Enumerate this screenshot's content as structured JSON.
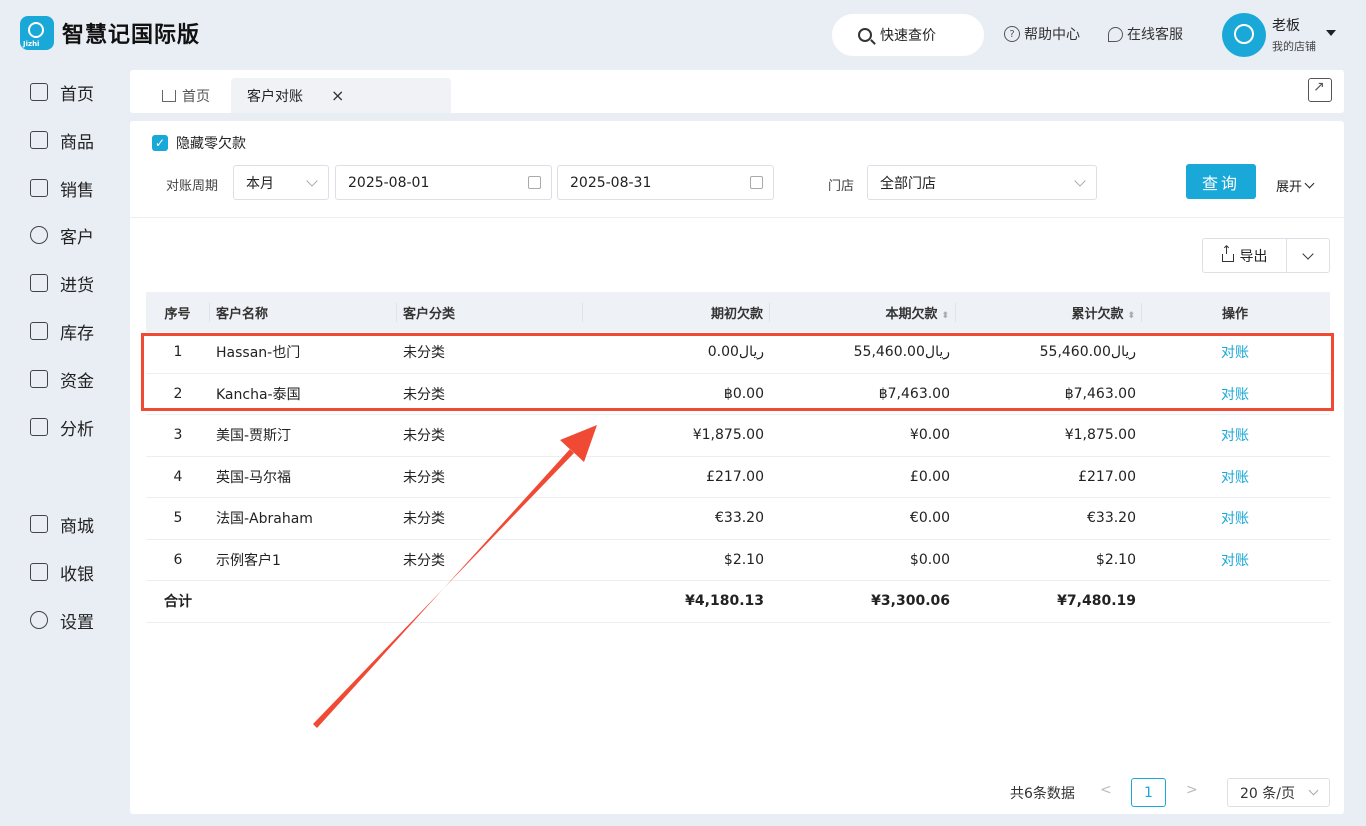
{
  "app": {
    "title": "智慧记国际版",
    "logo_tag": "Jizhi"
  },
  "header": {
    "quick_search": "快速查价",
    "help": "帮助中心",
    "service": "在线客服",
    "user_name": "老板",
    "user_store": "我的店铺"
  },
  "sidebar": {
    "items": [
      {
        "label": "首页",
        "icon": "home-icon"
      },
      {
        "label": "商品",
        "icon": "bag-icon"
      },
      {
        "label": "销售",
        "icon": "clipboard-icon"
      },
      {
        "label": "客户",
        "icon": "person-icon"
      },
      {
        "label": "进货",
        "icon": "box-icon"
      },
      {
        "label": "库存",
        "icon": "warehouse-icon"
      },
      {
        "label": "资金",
        "icon": "wallet-icon"
      },
      {
        "label": "分析",
        "icon": "chart-icon"
      },
      {
        "label": "商城",
        "icon": "shop-icon"
      },
      {
        "label": "收银",
        "icon": "cashier-icon"
      },
      {
        "label": "设置",
        "icon": "gear-icon"
      }
    ]
  },
  "tabs": {
    "home": "首页",
    "active": "客户对账",
    "close": "×"
  },
  "filters": {
    "hide_zero_label": "隐藏零欠款",
    "period_label": "对账周期",
    "period_value": "本月",
    "start_date": "2025-08-01",
    "end_date": "2025-08-31",
    "store_label": "门店",
    "store_value": "全部门店",
    "query_button": "查询",
    "expand_label": "展开"
  },
  "export": {
    "label": "导出"
  },
  "table": {
    "headers": [
      "序号",
      "客户名称",
      "客户分类",
      "期初欠款",
      "本期欠款",
      "累计欠款",
      "操作"
    ],
    "rows": [
      {
        "no": "1",
        "name": "Hassan-也门",
        "category": "未分类",
        "opening": "0.00ريال",
        "current": "55,460.00ريال",
        "cumulative": "55,460.00ريال",
        "action": "对账"
      },
      {
        "no": "2",
        "name": "Kancha-泰国",
        "category": "未分类",
        "opening": "฿0.00",
        "current": "฿7,463.00",
        "cumulative": "฿7,463.00",
        "action": "对账"
      },
      {
        "no": "3",
        "name": "美国-贾斯汀",
        "category": "未分类",
        "opening": "¥1,875.00",
        "current": "¥0.00",
        "cumulative": "¥1,875.00",
        "action": "对账"
      },
      {
        "no": "4",
        "name": "英国-马尔福",
        "category": "未分类",
        "opening": "£217.00",
        "current": "£0.00",
        "cumulative": "£217.00",
        "action": "对账"
      },
      {
        "no": "5",
        "name": "法国-Abraham",
        "category": "未分类",
        "opening": "€33.20",
        "current": "€0.00",
        "cumulative": "€33.20",
        "action": "对账"
      },
      {
        "no": "6",
        "name": "示例客户1",
        "category": "未分类",
        "opening": "$2.10",
        "current": "$0.00",
        "cumulative": "$2.10",
        "action": "对账"
      }
    ],
    "total": {
      "label": "合计",
      "opening": "¥4,180.13",
      "current": "¥3,300.06",
      "cumulative": "¥7,480.19"
    }
  },
  "pagination": {
    "total_text": "共6条数据",
    "prev": "<",
    "page": "1",
    "next": ">",
    "page_size": "20 条/页"
  },
  "colors": {
    "accent": "#1aa8d8",
    "highlight": "#f04a35",
    "background": "#e9eef5"
  }
}
